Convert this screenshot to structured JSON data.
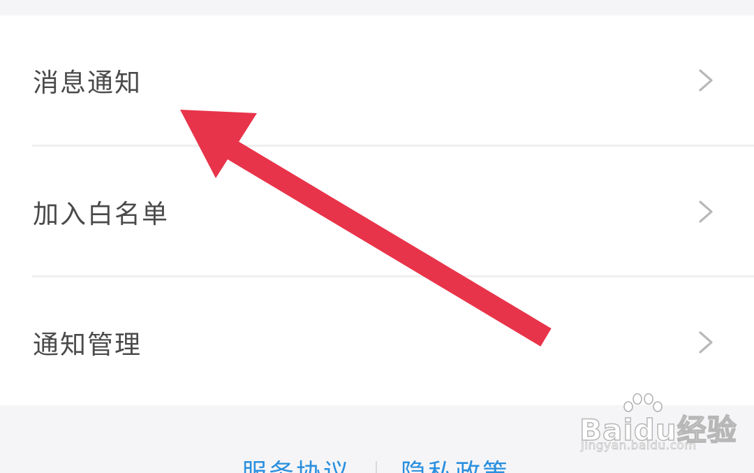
{
  "settings_list": {
    "items": [
      {
        "label": "消息通知"
      },
      {
        "label": "加入白名单"
      },
      {
        "label": "通知管理"
      }
    ]
  },
  "footer": {
    "links": [
      {
        "label": "服务协议"
      },
      {
        "label": "隐私政策"
      }
    ]
  },
  "annotation": {
    "arrow_color": "#e8344a"
  },
  "watermark": {
    "brand": "Baidu经验",
    "url": "jingyan.baidu.com"
  },
  "colors": {
    "background": "#f5f5f7",
    "card": "#ffffff",
    "label_text": "#4a4a4a",
    "chevron": "#b8b8b8",
    "divider": "#efefef",
    "link": "#2a8fde"
  }
}
